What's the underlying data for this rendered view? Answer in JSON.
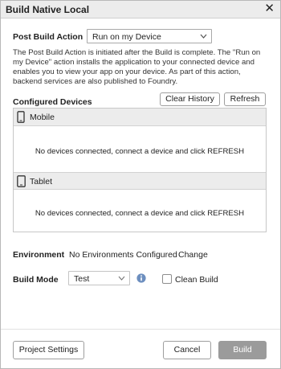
{
  "dialog": {
    "title": "Build Native Local",
    "close_glyph": "✕"
  },
  "post_build": {
    "label": "Post Build Action",
    "selected": "Run on my Device",
    "description": "The Post Build Action is initiated after the Build is complete. The \"Run on my Device\" action installs the application to your connected device and enables you to view your app on your device. As part of this action, backend services are also published to Foundry."
  },
  "configured_devices": {
    "label": "Configured Devices",
    "clear_history_label": "Clear History",
    "refresh_label": "Refresh",
    "groups": [
      {
        "name": "Mobile",
        "icon": "mobile-phone-icon",
        "message": "No devices connected, connect a device and click REFRESH"
      },
      {
        "name": "Tablet",
        "icon": "tablet-icon",
        "message": "No devices connected, connect a device and click REFRESH"
      }
    ]
  },
  "environment": {
    "label": "Environment",
    "value": "No Environments Configured",
    "change_label": "Change"
  },
  "build_mode": {
    "label": "Build Mode",
    "selected": "Test",
    "clean_build_label": "Clean Build",
    "clean_build_checked": false
  },
  "footer": {
    "project_settings_label": "Project Settings",
    "cancel_label": "Cancel",
    "build_label": "Build",
    "build_enabled": false
  },
  "colors": {
    "titlebar_bg": "#ececec",
    "device_header_bg": "#ececec",
    "disabled_button_bg": "#9b9b9b",
    "info_icon": "#6d8fbf"
  }
}
